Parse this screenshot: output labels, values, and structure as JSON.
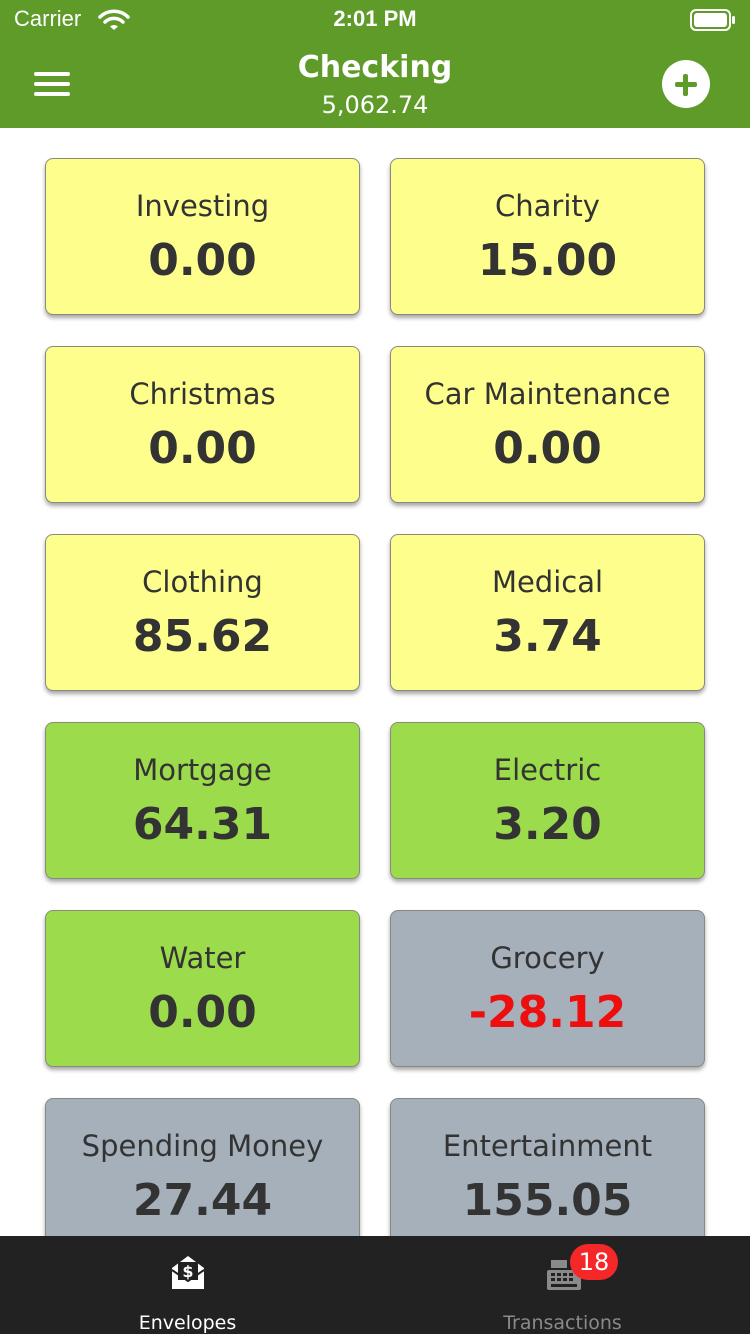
{
  "status_bar": {
    "carrier": "Carrier",
    "time": "2:01 PM",
    "wifi_icon": "wifi-icon",
    "battery_icon": "battery-icon"
  },
  "nav": {
    "title": "Checking",
    "balance": "5,062.74",
    "menu_icon": "menu-icon",
    "add_icon": "plus-icon"
  },
  "colors": {
    "brand_green": "#5e9b29",
    "card_yellow": "#fefe8c",
    "card_green": "#9cdc4c",
    "card_gray": "#a6b0bb",
    "negative_red": "#ee0e0e",
    "badge_red": "#f42828"
  },
  "envelopes": [
    {
      "name": "Investing",
      "amount": "0.00",
      "status": "yellow"
    },
    {
      "name": "Charity",
      "amount": "15.00",
      "status": "yellow"
    },
    {
      "name": "Christmas",
      "amount": "0.00",
      "status": "yellow"
    },
    {
      "name": "Car Maintenance",
      "amount": "0.00",
      "status": "yellow"
    },
    {
      "name": "Clothing",
      "amount": "85.62",
      "status": "yellow"
    },
    {
      "name": "Medical",
      "amount": "3.74",
      "status": "yellow"
    },
    {
      "name": "Mortgage",
      "amount": "64.31",
      "status": "green"
    },
    {
      "name": "Electric",
      "amount": "3.20",
      "status": "green"
    },
    {
      "name": "Water",
      "amount": "0.00",
      "status": "green"
    },
    {
      "name": "Grocery",
      "amount": "-28.12",
      "status": "gray",
      "negative": true
    },
    {
      "name": "Spending Money",
      "amount": "27.44",
      "status": "gray"
    },
    {
      "name": "Entertainment",
      "amount": "155.05",
      "status": "gray"
    }
  ],
  "tabs": [
    {
      "label": "Envelopes",
      "icon": "envelope-dollar-icon",
      "selected": true
    },
    {
      "label": "Transactions",
      "icon": "cash-register-icon",
      "selected": false,
      "badge": "18"
    }
  ]
}
